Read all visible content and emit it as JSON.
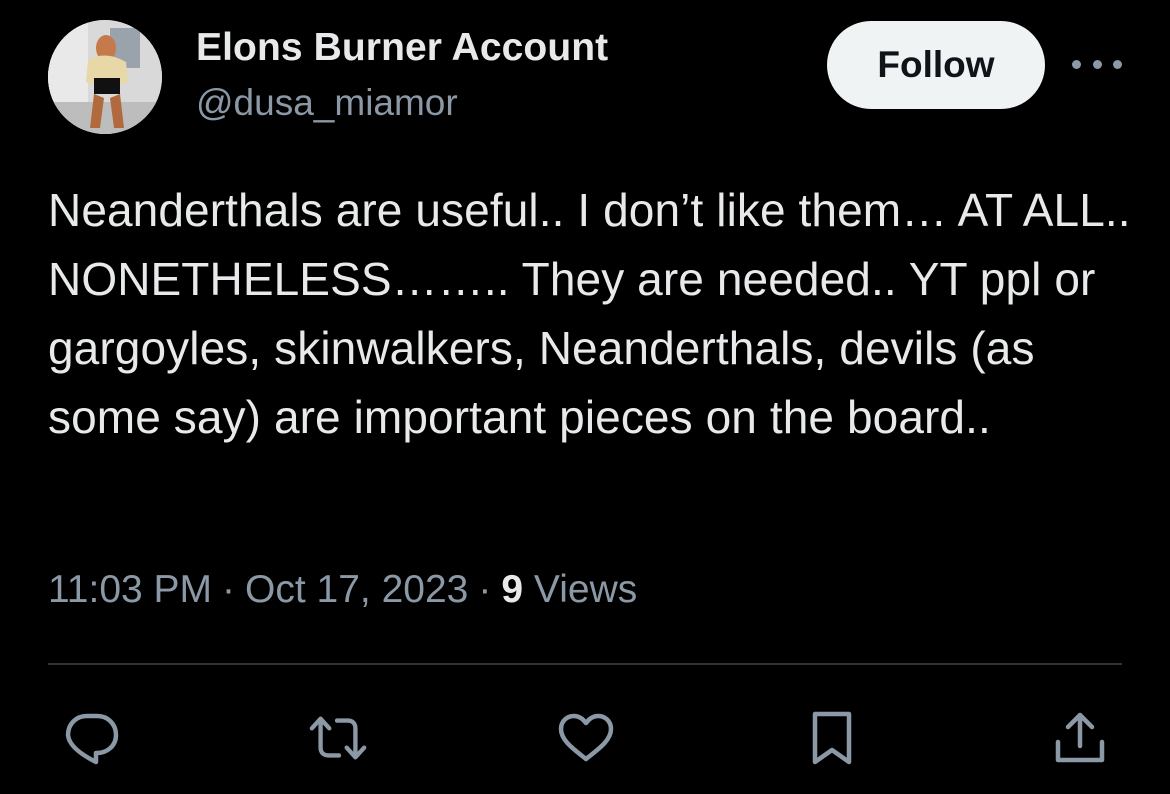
{
  "author": {
    "display_name": "Elons Burner Account",
    "handle": "@dusa_miamor"
  },
  "buttons": {
    "follow_label": "Follow",
    "more_icon": "more-horizontal-icon"
  },
  "tweet": {
    "text": "Neanderthals are useful.. I don’t like them… AT ALL.. NONETHELESS…….. They are needed.. YT ppl or gargoyles, skinwalkers, Neanderthals, devils (as some say) are important pieces on the board..",
    "time": "11:03 PM",
    "separator": "·",
    "date": "Oct 17, 2023",
    "views_count": "9",
    "views_label": "Views"
  },
  "actions": [
    {
      "name": "reply",
      "icon": "reply-icon"
    },
    {
      "name": "retweet",
      "icon": "retweet-icon"
    },
    {
      "name": "like",
      "icon": "heart-icon"
    },
    {
      "name": "bookmark",
      "icon": "bookmark-icon"
    },
    {
      "name": "share",
      "icon": "share-icon"
    }
  ],
  "colors": {
    "background": "#000000",
    "primary_text": "#e7e9ea",
    "secondary_text": "#8b98a5",
    "follow_button_bg": "#eff3f4",
    "divider": "#2f3336"
  }
}
